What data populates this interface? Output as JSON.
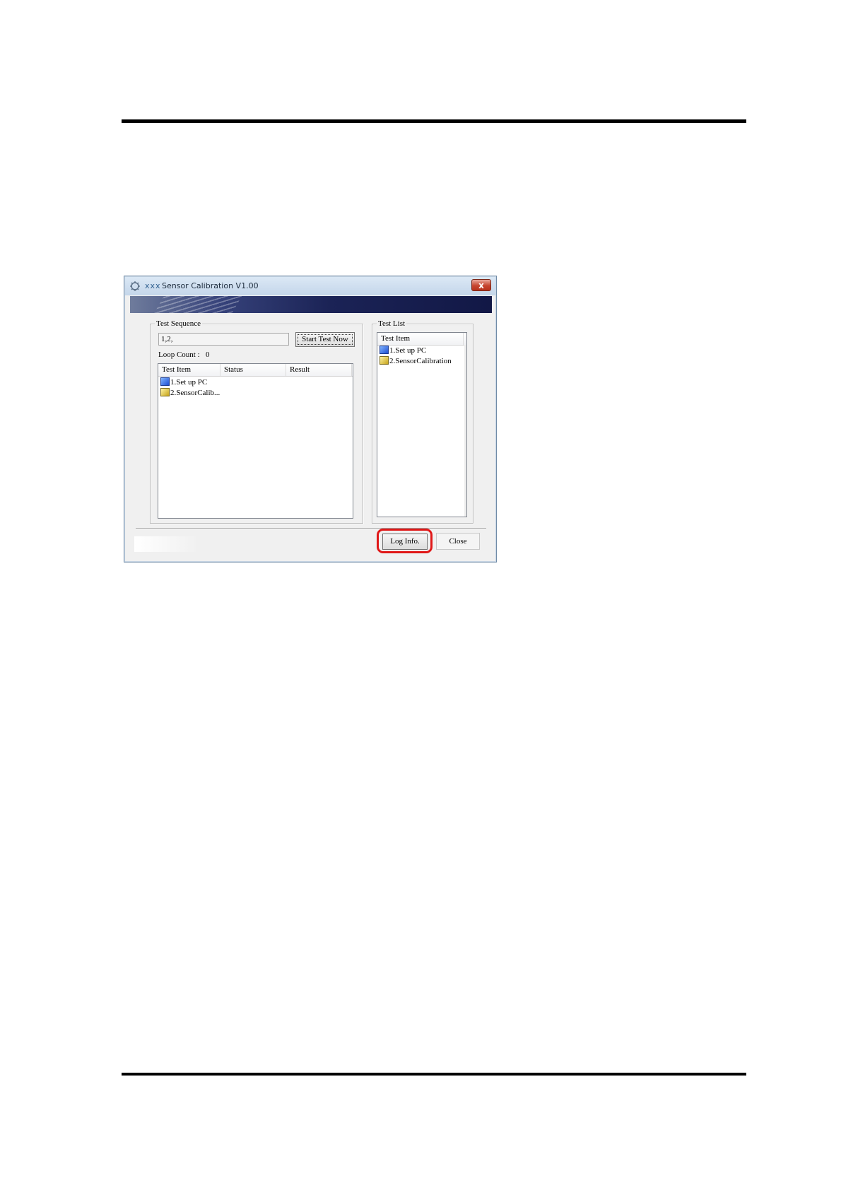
{
  "window": {
    "title_brand": "xxx",
    "title": "Sensor Calibration V1.00",
    "close_glyph": "x"
  },
  "test_sequence": {
    "group_label": "Test Sequence",
    "sequence_value": "1,2,",
    "start_button": "Start Test Now",
    "loop_count_label": "Loop Count :",
    "loop_count_value": "0",
    "columns": [
      "Test Item",
      "Status",
      "Result"
    ],
    "rows": [
      {
        "icon": "monitor-icon",
        "label": "1.Set up PC"
      },
      {
        "icon": "calibration-icon",
        "label": "2.SensorCalib..."
      }
    ]
  },
  "test_list": {
    "group_label": "Test List",
    "column": "Test Item",
    "rows": [
      {
        "icon": "monitor-icon",
        "label": "1.Set up PC"
      },
      {
        "icon": "calibration-icon",
        "label": "2.SensorCalibration"
      }
    ]
  },
  "footer": {
    "log_button": "Log Info.",
    "close_button": "Close",
    "highlight_color": "#e01717"
  }
}
